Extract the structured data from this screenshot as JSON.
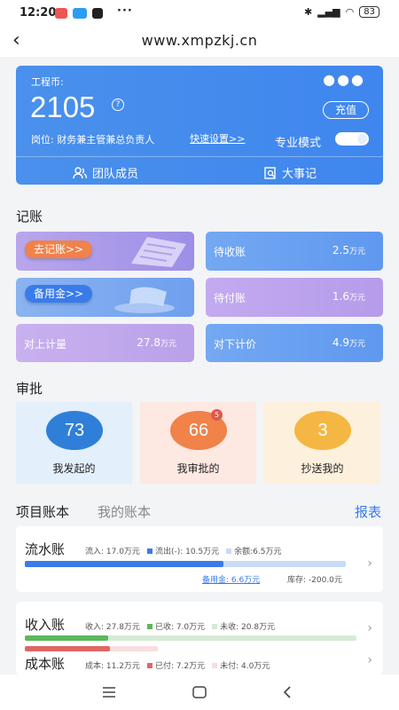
{
  "status": {
    "time": "12:20",
    "dots": "···",
    "battery": "83"
  },
  "nav": {
    "title": "www.xmpzkj.cn"
  },
  "card": {
    "coin_label": "工程币:",
    "coin_value": "2105",
    "question": "?",
    "recharge": "充值",
    "post": "岗位: 财务兼主管兼总负责人",
    "quick_setup": "快速设置>>",
    "pro_mode": "专业模式",
    "team": "团队成员",
    "events": "大事记"
  },
  "accounting": {
    "heading": "记账",
    "go_record": "去记账>>",
    "reserve": "备用金>>",
    "receivable": {
      "label": "待收账",
      "value": "2.5",
      "unit": "万元"
    },
    "payable": {
      "label": "待付账",
      "value": "1.6",
      "unit": "万元"
    },
    "upper_measure": {
      "label": "对上计量",
      "value": "27.8",
      "unit": "万元"
    },
    "lower_price": {
      "label": "对下计价",
      "value": "4.9",
      "unit": "万元"
    }
  },
  "approval": {
    "heading": "审批",
    "initiated": {
      "count": "73",
      "label": "我发起的"
    },
    "review": {
      "count": "66",
      "label": "我审批的",
      "badge": "5"
    },
    "cc": {
      "count": "3",
      "label": "抄送我的"
    }
  },
  "tabs": {
    "project": "项目账本",
    "mine": "我的账本",
    "report": "报表"
  },
  "flow": {
    "title": "流水账",
    "income": "流入: 17.0万元",
    "outflow": "流出(-): 10.5万元",
    "balance": "余额:6.5万元",
    "reserve": "备用金: 6.6万元",
    "stock": "库存: -200.0元",
    "ratio": 0.62
  },
  "income_ledger": {
    "title": "收入账",
    "income": "收入: 27.8万元",
    "received": "已收: 7.0万元",
    "unreceived": "未收: 20.8万元",
    "ratio": 0.25
  },
  "cost_ledger": {
    "title": "成本账",
    "cost": "成本: 11.2万元",
    "paid": "已付: 7.2万元",
    "unpaid": "未付: 4.0万元",
    "ratio": 0.64
  },
  "colors": {
    "blue": "#3f86ee",
    "green": "#5cb85c",
    "red": "#e06666",
    "orange": "#f0824a",
    "yellow": "#f5b743"
  }
}
